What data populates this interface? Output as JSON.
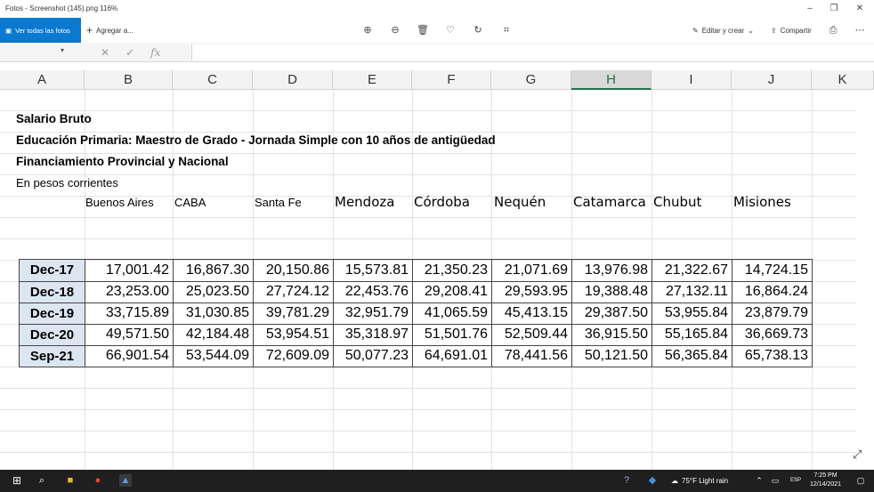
{
  "window": {
    "title": "Fotos - Screenshot (145).png   116%",
    "minimize": "–",
    "maximize": "❐",
    "close": "✕"
  },
  "toolbar": {
    "view_all": "Ver todas las fotos",
    "add_to": "Agregar a...",
    "edit_create": "Editar y crear",
    "share": "Compartir",
    "icons": [
      "zoom-in",
      "zoom-out",
      "delete",
      "favorite",
      "rotate",
      "crop"
    ]
  },
  "sheet": {
    "columns": [
      "A",
      "B",
      "C",
      "D",
      "E",
      "F",
      "G",
      "H",
      "I",
      "J",
      "K"
    ],
    "active_column": "H",
    "line1": "Salario Bruto",
    "line2": "Educación Primaria: Maestro de Grado - Jornada Simple con 10 años de antigüedad",
    "line3": "Financiamiento Provincial y Nacional",
    "line4": "En pesos corrientes",
    "provinces": [
      "Buenos Aires",
      "CABA",
      "Santa Fe",
      "Mendoza",
      "Córdoba",
      "Nequén",
      "Catamarca",
      "Chubut",
      "Misiones"
    ],
    "rows": [
      {
        "label": "Dec-17",
        "values": [
          "17,001.42",
          "16,867.30",
          "20,150.86",
          "15,573.81",
          "21,350.23",
          "21,071.69",
          "13,976.98",
          "21,322.67",
          "14,724.15"
        ]
      },
      {
        "label": "Dec-18",
        "values": [
          "23,253.00",
          "25,023.50",
          "27,724.12",
          "22,453.76",
          "29,208.41",
          "29,593.95",
          "19,388.48",
          "27,132.11",
          "16,864.24"
        ]
      },
      {
        "label": "Dec-19",
        "values": [
          "33,715.89",
          "31,030.85",
          "39,781.29",
          "32,951.79",
          "41,065.59",
          "45,413.15",
          "29,387.50",
          "53,955.84",
          "23,879.79"
        ]
      },
      {
        "label": "Dec-20",
        "values": [
          "49,571.50",
          "42,184.48",
          "53,954.51",
          "35,318.97",
          "51,501.76",
          "52,509.44",
          "36,915.50",
          "55,165.84",
          "36,669.73"
        ]
      },
      {
        "label": "Sep-21",
        "values": [
          "66,901.54",
          "53,544.09",
          "72,609.09",
          "50,077.23",
          "64,691.01",
          "78,441.56",
          "50,121.50",
          "56,365.84",
          "65,738.13"
        ]
      }
    ]
  },
  "taskbar": {
    "weather": "75°F  Light rain",
    "lang": "ESP",
    "time": "7:25 PM",
    "date": "12/14/2021"
  }
}
